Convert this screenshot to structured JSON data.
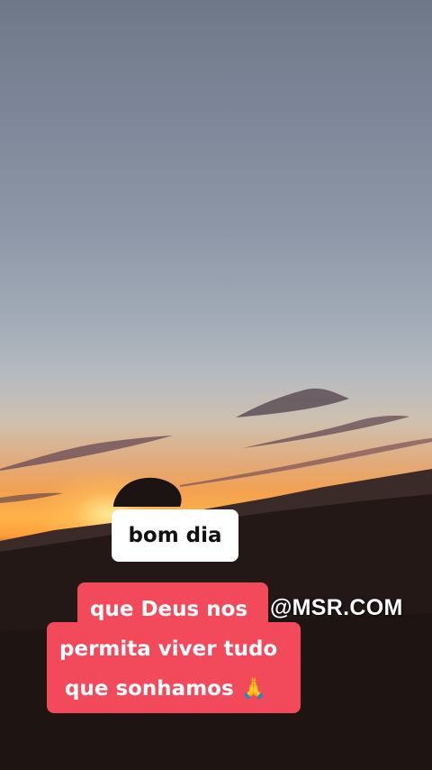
{
  "captions": {
    "greeting": "bom dia",
    "line1": "que Deus nos",
    "line2": "permita viver tudo",
    "line3": "que sonhamos 🙏"
  },
  "watermark": "@MSR.COM",
  "colors": {
    "caption_white": "#ffffff",
    "caption_red": "#f2495b",
    "text_dark": "#111111",
    "text_light": "#ffffff"
  }
}
